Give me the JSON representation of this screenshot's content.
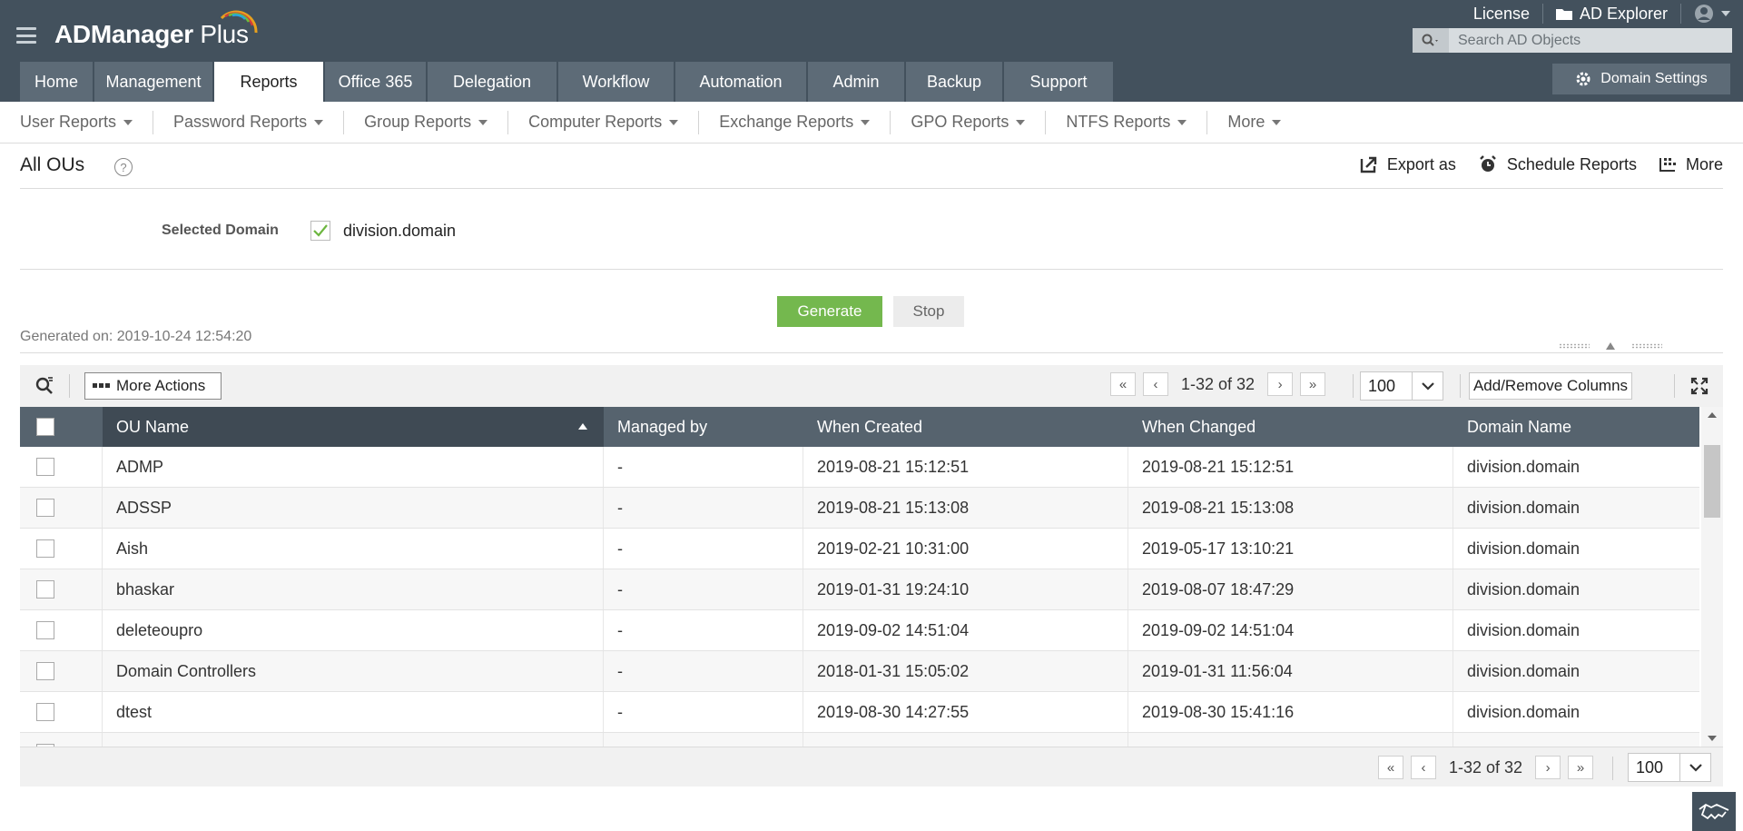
{
  "app": {
    "logo_main": "ADManager",
    "logo_plus": " Plus",
    "logo_arc_colors": [
      "#e7a11e",
      "#2aa5dc",
      "#6cbf3b",
      "#d23b3b"
    ]
  },
  "top_links": {
    "license": "License",
    "ad_explorer": "AD Explorer"
  },
  "search": {
    "placeholder": "Search AD Objects"
  },
  "tabs": [
    {
      "label": "Home",
      "active": false
    },
    {
      "label": "Management",
      "active": false
    },
    {
      "label": "Reports",
      "active": true
    },
    {
      "label": "Office 365",
      "active": false
    },
    {
      "label": "Delegation",
      "active": false
    },
    {
      "label": "Workflow",
      "active": false
    },
    {
      "label": "Automation",
      "active": false
    },
    {
      "label": "Admin",
      "active": false
    },
    {
      "label": "Backup",
      "active": false
    },
    {
      "label": "Support",
      "active": false
    }
  ],
  "domain_settings": "Domain Settings",
  "submenu": [
    "User Reports",
    "Password Reports",
    "Group Reports",
    "Computer Reports",
    "Exchange Reports",
    "GPO Reports",
    "NTFS Reports",
    "More"
  ],
  "page": {
    "title": "All OUs",
    "help": "?",
    "actions": {
      "export": "Export as",
      "schedule": "Schedule Reports",
      "more": "More"
    }
  },
  "domain_selector": {
    "label": "Selected Domain",
    "value": "division.domain",
    "checked": true
  },
  "buttons": {
    "generate": "Generate",
    "stop": "Stop"
  },
  "generated_on": "Generated on: 2019-10-24 12:54:20",
  "toolbar": {
    "more_actions": "More Actions",
    "pager_text": "1-32 of 32",
    "page_size": "100",
    "add_remove": "Add/Remove Columns"
  },
  "table": {
    "headers": {
      "ou_name": "OU Name",
      "managed_by": "Managed by",
      "when_created": "When Created",
      "when_changed": "When Changed",
      "domain_name": "Domain Name"
    },
    "rows": [
      {
        "ou_name": "ADMP",
        "managed_by": "-",
        "when_created": "2019-08-21 15:12:51",
        "when_changed": "2019-08-21 15:12:51",
        "domain_name": "division.domain"
      },
      {
        "ou_name": "ADSSP",
        "managed_by": "-",
        "when_created": "2019-08-21 15:13:08",
        "when_changed": "2019-08-21 15:13:08",
        "domain_name": "division.domain"
      },
      {
        "ou_name": "Aish",
        "managed_by": "-",
        "when_created": "2019-02-21 10:31:00",
        "when_changed": "2019-05-17 13:10:21",
        "domain_name": "division.domain"
      },
      {
        "ou_name": "bhaskar",
        "managed_by": "-",
        "when_created": "2019-01-31 19:24:10",
        "when_changed": "2019-08-07 18:47:29",
        "domain_name": "division.domain"
      },
      {
        "ou_name": "deleteoupro",
        "managed_by": "-",
        "when_created": "2019-09-02 14:51:04",
        "when_changed": "2019-09-02 14:51:04",
        "domain_name": "division.domain"
      },
      {
        "ou_name": "Domain Controllers",
        "managed_by": "-",
        "when_created": "2018-01-31 15:05:02",
        "when_changed": "2019-01-31 11:56:04",
        "domain_name": "division.domain"
      },
      {
        "ou_name": "dtest",
        "managed_by": "-",
        "when_created": "2019-08-30 14:27:55",
        "when_changed": "2019-08-30 15:41:16",
        "domain_name": "division.domain"
      }
    ]
  },
  "footer_pager": {
    "text": "1-32 of 32",
    "page_size": "100"
  },
  "colors": {
    "header_bg": "#43515d",
    "tab_bg": "#5d6b77",
    "table_header_bg": "#56636e",
    "generate_green": "#74b84e"
  }
}
